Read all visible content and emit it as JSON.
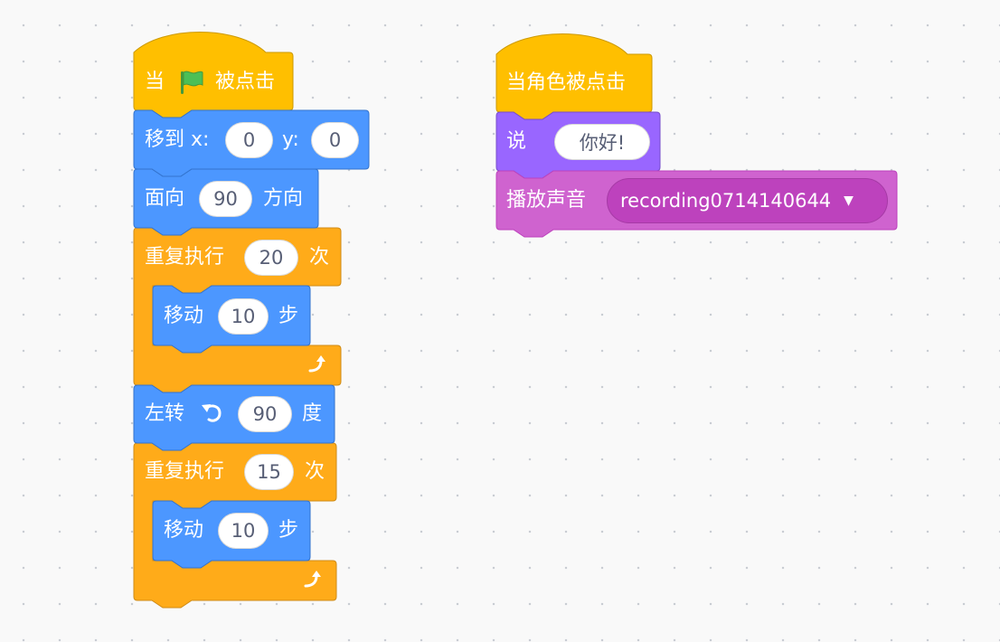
{
  "scripts": [
    {
      "name": "flag-script",
      "blocks": [
        {
          "hat_left": "当",
          "flag_icon": "green-flag-icon",
          "hat_right": "被点击"
        },
        {
          "label": "移到 x:",
          "x": "0",
          "y_label": "y:",
          "y": "0"
        },
        {
          "label": "面向",
          "value": "90",
          "suffix": "方向"
        },
        {
          "label": "重复执行",
          "value": "20",
          "suffix": "次",
          "loop_icon": "loop-arrow-icon",
          "inner": {
            "label": "移动",
            "value": "10",
            "suffix": "步"
          }
        },
        {
          "label": "左转",
          "turn_icon": "rotate-left-icon",
          "value": "90",
          "suffix": "度"
        },
        {
          "label": "重复执行",
          "value": "15",
          "suffix": "次",
          "loop_icon": "loop-arrow-icon",
          "inner": {
            "label": "移动",
            "value": "10",
            "suffix": "步"
          }
        }
      ]
    },
    {
      "name": "sprite-click-script",
      "blocks": [
        {
          "hat": "当角色被点击"
        },
        {
          "label": "说",
          "value": "你好!"
        },
        {
          "label": "播放声音",
          "sound": "recording0714140644",
          "caret_icon": "dropdown-caret-icon"
        }
      ]
    }
  ],
  "colors": {
    "events": "#ffbf00",
    "events_border": "#cc9900",
    "motion": "#4c97ff",
    "motion_border": "#3373cc",
    "control": "#ffab19",
    "control_border": "#cf8b17",
    "looks": "#9966ff",
    "looks_border": "#774dcb",
    "sound": "#cf63cf",
    "sound_border": "#bd42bd"
  }
}
